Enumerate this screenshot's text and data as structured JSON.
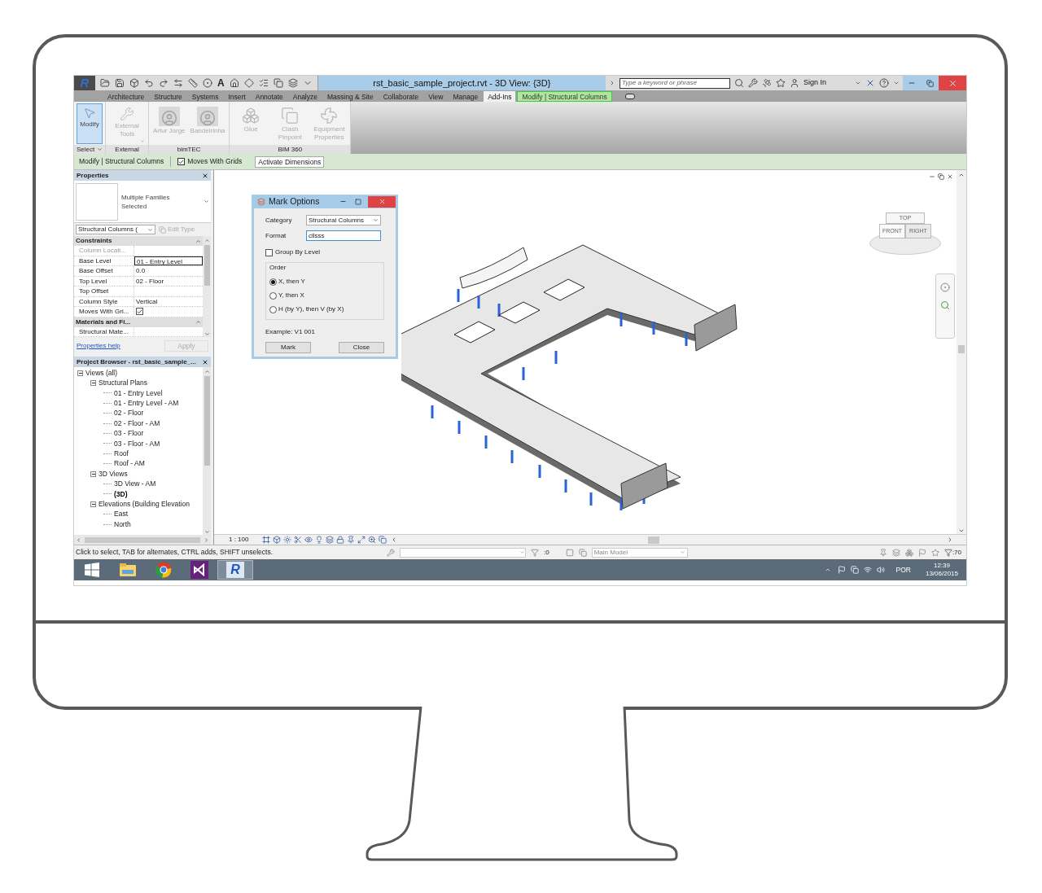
{
  "window": {
    "title": "rst_basic_sample_project.rvt - 3D View: {3D}",
    "app_letter": "R",
    "quick_access_text_tool": "A"
  },
  "infocenter": {
    "search_placeholder": "Type a keyword or phrase",
    "sign_in": "Sign In"
  },
  "ribbon_tabs": [
    {
      "label": "Architecture",
      "selected": false,
      "kind": "tab"
    },
    {
      "label": "Structure",
      "selected": false,
      "kind": "tab"
    },
    {
      "label": "Systems",
      "selected": false,
      "kind": "tab"
    },
    {
      "label": "Insert",
      "selected": false,
      "kind": "tab"
    },
    {
      "label": "Annotate",
      "selected": false,
      "kind": "tab"
    },
    {
      "label": "Analyze",
      "selected": false,
      "kind": "tab"
    },
    {
      "label": "Massing & Site",
      "selected": false,
      "kind": "tab"
    },
    {
      "label": "Collaborate",
      "selected": false,
      "kind": "tab"
    },
    {
      "label": "View",
      "selected": false,
      "kind": "tab"
    },
    {
      "label": "Manage",
      "selected": false,
      "kind": "tab"
    },
    {
      "label": "Add-Ins",
      "selected": true,
      "kind": "tab"
    },
    {
      "label": "Modify | Structural Columns",
      "selected": false,
      "kind": "contextual"
    }
  ],
  "ribbon_panels": [
    {
      "label": "Select",
      "dropdown": true,
      "buttons": [
        {
          "label": "Modify",
          "kind": "pointer",
          "selected": true,
          "disabled": false,
          "dropdown": false
        }
      ]
    },
    {
      "label": "External",
      "dropdown": false,
      "buttons": [
        {
          "label": "External Tools",
          "kind": "tools",
          "selected": false,
          "disabled": true,
          "dropdown": true
        }
      ]
    },
    {
      "label": "bimTEC",
      "dropdown": false,
      "buttons": [
        {
          "label": "Artur Jorge",
          "kind": "photo",
          "selected": false,
          "disabled": true,
          "dropdown": false
        },
        {
          "label": "Bandeirinha",
          "kind": "photo",
          "selected": false,
          "disabled": true,
          "dropdown": false
        }
      ]
    },
    {
      "label": "BIM 360",
      "dropdown": false,
      "buttons": [
        {
          "label": "Glue",
          "kind": "glue",
          "selected": false,
          "disabled": true,
          "dropdown": false
        },
        {
          "label": "Clash Pinpoint",
          "kind": "clash",
          "selected": false,
          "disabled": true,
          "dropdown": false
        },
        {
          "label": "Equipment Properties",
          "kind": "fan",
          "selected": false,
          "disabled": true,
          "dropdown": false
        }
      ]
    }
  ],
  "options_bar": {
    "context": "Modify | Structural Columns",
    "moves_with_grids": {
      "label": "Moves With Grids",
      "checked": true
    },
    "activate_dimensions": "Activate Dimensions"
  },
  "properties": {
    "title": "Properties",
    "type_name": "Multiple Families Selected",
    "selector": "Structural Columns (",
    "edit_type": {
      "label": "Edit Type",
      "disabled": true
    },
    "groups": [
      {
        "label": "Constraints",
        "expanded": true,
        "rows": [
          {
            "label": "Column Locati...",
            "kind": "text",
            "disabled": true,
            "selected": false
          },
          {
            "label": "Base Level",
            "value": "01 - Entry Level",
            "kind": "text",
            "disabled": false,
            "selected": true
          },
          {
            "label": "Base Offset",
            "value": "0.0",
            "kind": "text",
            "disabled": false,
            "selected": false
          },
          {
            "label": "Top Level",
            "value": "02 - Floor",
            "kind": "text",
            "disabled": false,
            "selected": false
          },
          {
            "label": "Top Offset",
            "kind": "text",
            "disabled": false,
            "selected": false
          },
          {
            "label": "Column Style",
            "value": "Vertical",
            "kind": "text",
            "disabled": false,
            "selected": false
          },
          {
            "label": "Moves With Gri...",
            "kind": "checkbox",
            "checked": true,
            "disabled": false,
            "selected": false
          }
        ]
      },
      {
        "label": "Materials and Fi...",
        "expanded": true,
        "rows": [
          {
            "label": "Structural Mate...",
            "kind": "text",
            "disabled": false,
            "selected": false
          }
        ]
      }
    ],
    "help": "Properties help",
    "apply": {
      "label": "Apply",
      "disabled": true
    }
  },
  "project_browser": {
    "title": "Project Browser - rst_basic_sample_...",
    "tree": [
      {
        "label": "Views (all)",
        "expanded": true,
        "current": false,
        "children": [
          {
            "label": "Structural Plans",
            "expanded": true,
            "current": false,
            "children": [
              {
                "label": "01 - Entry Level",
                "current": false
              },
              {
                "label": "01 - Entry Level - AM",
                "current": false
              },
              {
                "label": "02 - Floor",
                "current": false
              },
              {
                "label": "02 - Floor - AM",
                "current": false
              },
              {
                "label": "03 - Floor",
                "current": false
              },
              {
                "label": "03 - Floor - AM",
                "current": false
              },
              {
                "label": "Roof",
                "current": false
              },
              {
                "label": "Roof - AM",
                "current": false
              }
            ]
          },
          {
            "label": "3D Views",
            "expanded": true,
            "current": false,
            "children": [
              {
                "label": "3D View - AM",
                "current": false
              },
              {
                "label": "(3D)",
                "current": true
              }
            ]
          },
          {
            "label": "Elevations (Building Elevation",
            "expanded": true,
            "current": false,
            "children": [
              {
                "label": "East",
                "current": false
              },
              {
                "label": "North",
                "current": false
              }
            ]
          }
        ]
      }
    ]
  },
  "view": {
    "scale": "1 : 100",
    "viewcube": {
      "top": "TOP",
      "front": "FRONT",
      "right": "RIGHT"
    }
  },
  "dialog": {
    "title": "Mark Options",
    "category_label": "Category",
    "category": "Structural Columns",
    "format_label": "Format",
    "format": "cllsss",
    "group_by_level": {
      "label": "Group By Level",
      "checked": false
    },
    "order_label": "Order",
    "order": [
      {
        "label": "X, then Y",
        "selected": true
      },
      {
        "label": "Y, then X",
        "selected": false
      },
      {
        "label": "H (by Y), then V (by X)",
        "selected": false
      }
    ],
    "example": "Example: V1 001",
    "buttons": [
      "Mark",
      "Close"
    ]
  },
  "status_bar": {
    "text": "Click to select, TAB for alternates, CTRL adds, SHIFT unselects.",
    "selection_count": ":0",
    "model": "Main Model",
    "filter_count": ":70"
  },
  "taskbar": {
    "apps": [
      {
        "kind": "start",
        "selected": false
      },
      {
        "kind": "explorer",
        "selected": false
      },
      {
        "kind": "browser",
        "selected": false
      },
      {
        "kind": "visual-studio",
        "selected": false
      },
      {
        "kind": "revit",
        "selected": true,
        "letter": "R"
      }
    ],
    "language": "POR",
    "time": "12:39",
    "date": "13/06/2015"
  }
}
